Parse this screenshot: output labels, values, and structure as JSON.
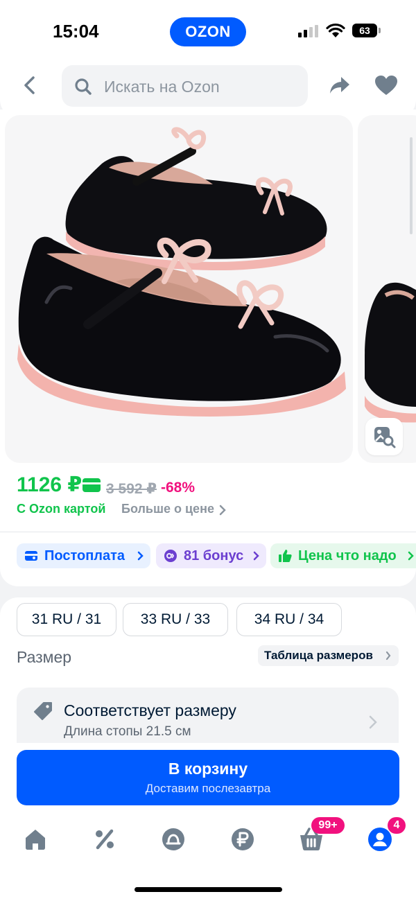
{
  "status_bar": {
    "time": "15:04",
    "brand": "OZON",
    "battery": "63"
  },
  "header": {
    "search_placeholder": "Искать на Ozon"
  },
  "price": {
    "current": "1126 ₽",
    "old": "3 592 ₽",
    "discount": "-68%",
    "card_label": "С Ozon картой",
    "more_label": "Больше о цене"
  },
  "chips": [
    {
      "label": "Постоплата"
    },
    {
      "label": "81 бонус"
    },
    {
      "label": "Цена что надо"
    }
  ],
  "sizes": {
    "options": [
      "31 RU / 31",
      "33 RU / 33",
      "34 RU / 34"
    ],
    "label": "Размер",
    "table_label": "Таблица размеров"
  },
  "fit": {
    "title": "Соответствует размеру",
    "subtitle": "Длина стопы 21.5 см"
  },
  "cart": {
    "title": "В корзину",
    "subtitle": "Доставим послезавтра"
  },
  "tabbar": {
    "cart_badge": "99+",
    "profile_badge": "4"
  },
  "colors": {
    "accent": "#005bff",
    "price_green": "#10c44c",
    "discount_pink": "#f1117e",
    "icon_grey": "#707f8d"
  }
}
